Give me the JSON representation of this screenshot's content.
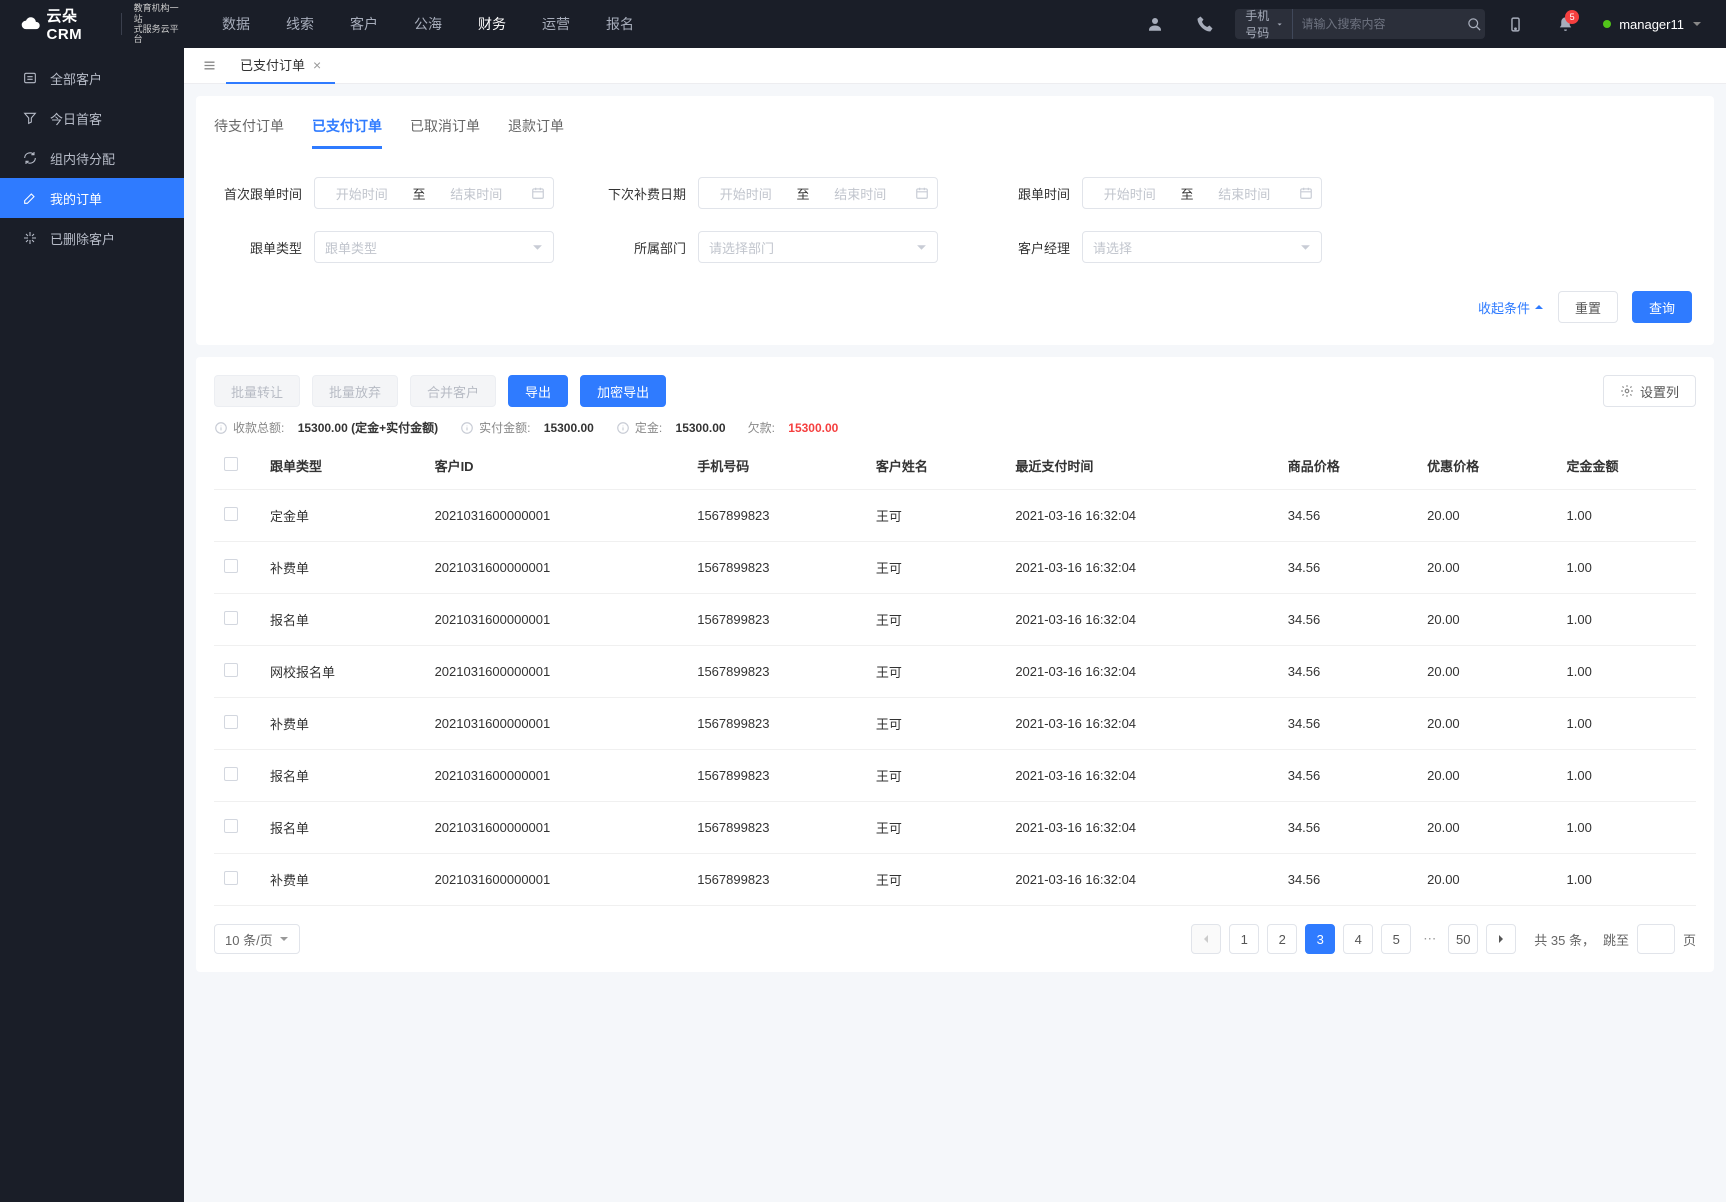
{
  "brand": {
    "name": "云朵CRM",
    "sub1": "教育机构一站",
    "sub2": "式服务云平台"
  },
  "top_nav": [
    "数据",
    "线索",
    "客户",
    "公海",
    "财务",
    "运营",
    "报名"
  ],
  "top_nav_active": 4,
  "search": {
    "prefix": "手机号码",
    "placeholder": "请输入搜索内容"
  },
  "notif_count": "5",
  "user_name": "manager11",
  "sidebar": [
    {
      "icon": "users",
      "label": "全部客户"
    },
    {
      "icon": "funnel",
      "label": "今日首客"
    },
    {
      "icon": "refresh",
      "label": "组内待分配"
    },
    {
      "icon": "edit",
      "label": "我的订单"
    },
    {
      "icon": "trash",
      "label": "已删除客户"
    }
  ],
  "sidebar_active": 3,
  "page_tab": "已支付订单",
  "sub_tabs": [
    "待支付订单",
    "已支付订单",
    "已取消订单",
    "退款订单"
  ],
  "sub_tab_active": 1,
  "filters": {
    "first_follow": {
      "label": "首次跟单时间",
      "start_ph": "开始时间",
      "sep": "至",
      "end_ph": "结束时间"
    },
    "next_fee": {
      "label": "下次补费日期",
      "start_ph": "开始时间",
      "sep": "至",
      "end_ph": "结束时间"
    },
    "follow_time": {
      "label": "跟单时间",
      "start_ph": "开始时间",
      "sep": "至",
      "end_ph": "结束时间"
    },
    "follow_type": {
      "label": "跟单类型",
      "ph": "跟单类型"
    },
    "dept": {
      "label": "所属部门",
      "ph": "请选择部门"
    },
    "manager": {
      "label": "客户经理",
      "ph": "请选择"
    }
  },
  "filter_footer": {
    "collapse": "收起条件",
    "reset": "重置",
    "query": "查询"
  },
  "actions": {
    "transfer": "批量转让",
    "abandon": "批量放弃",
    "merge": "合并客户",
    "export": "导出",
    "enc_export": "加密导出",
    "cols": "设置列"
  },
  "summary": {
    "total_label": "收款总额:",
    "total_value": "15300.00 (定金+实付金额)",
    "paid_label": "实付金额:",
    "paid_value": "15300.00",
    "deposit_label": "定金:",
    "deposit_value": "15300.00",
    "due_label": "欠款:",
    "due_value": "15300.00"
  },
  "columns": [
    "跟单类型",
    "客户ID",
    "手机号码",
    "客户姓名",
    "最近支付时间",
    "商品价格",
    "优惠价格",
    "定金金额"
  ],
  "rows": [
    {
      "type": "定金单",
      "cid": "2021031600000001",
      "phone": "1567899823",
      "name": "王可",
      "time": "2021-03-16 16:32:04",
      "price": "34.56",
      "disc": "20.00",
      "dep": "1.00"
    },
    {
      "type": "补费单",
      "cid": "2021031600000001",
      "phone": "1567899823",
      "name": "王可",
      "time": "2021-03-16 16:32:04",
      "price": "34.56",
      "disc": "20.00",
      "dep": "1.00"
    },
    {
      "type": "报名单",
      "cid": "2021031600000001",
      "phone": "1567899823",
      "name": "王可",
      "time": "2021-03-16 16:32:04",
      "price": "34.56",
      "disc": "20.00",
      "dep": "1.00"
    },
    {
      "type": "网校报名单",
      "cid": "2021031600000001",
      "phone": "1567899823",
      "name": "王可",
      "time": "2021-03-16 16:32:04",
      "price": "34.56",
      "disc": "20.00",
      "dep": "1.00"
    },
    {
      "type": "补费单",
      "cid": "2021031600000001",
      "phone": "1567899823",
      "name": "王可",
      "time": "2021-03-16 16:32:04",
      "price": "34.56",
      "disc": "20.00",
      "dep": "1.00"
    },
    {
      "type": "报名单",
      "cid": "2021031600000001",
      "phone": "1567899823",
      "name": "王可",
      "time": "2021-03-16 16:32:04",
      "price": "34.56",
      "disc": "20.00",
      "dep": "1.00"
    },
    {
      "type": "报名单",
      "cid": "2021031600000001",
      "phone": "1567899823",
      "name": "王可",
      "time": "2021-03-16 16:32:04",
      "price": "34.56",
      "disc": "20.00",
      "dep": "1.00"
    },
    {
      "type": "补费单",
      "cid": "2021031600000001",
      "phone": "1567899823",
      "name": "王可",
      "time": "2021-03-16 16:32:04",
      "price": "34.56",
      "disc": "20.00",
      "dep": "1.00"
    }
  ],
  "pagination": {
    "size": "10 条/页",
    "pages": [
      "1",
      "2",
      "3",
      "4",
      "5"
    ],
    "active": 2,
    "last": "50",
    "total_prefix": "共 ",
    "total_mid": "35",
    "total_suffix": " 条，",
    "jump_label": "跳至",
    "jump_suffix": "页"
  }
}
